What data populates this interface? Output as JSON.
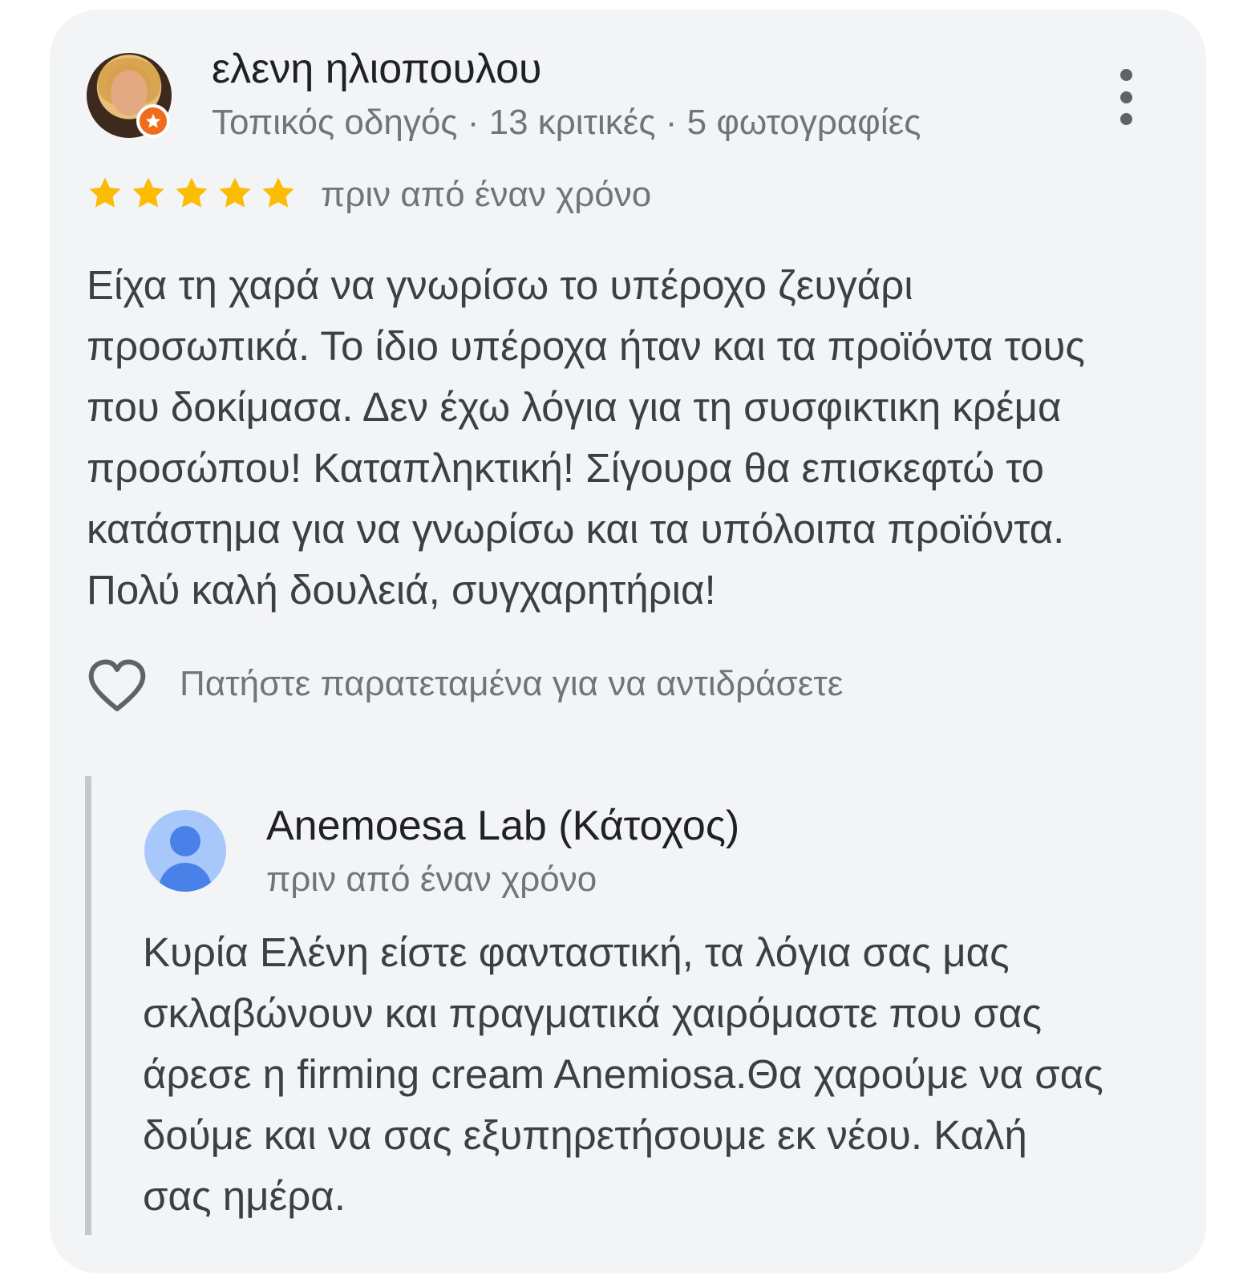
{
  "review": {
    "author_name": "ελενη ηλιοπουλου",
    "author_meta": "Τοπικός οδηγός · 13 κριτικές · 5 φωτογραφίες",
    "rating": 5,
    "rating_max": 5,
    "date": "πριν από έναν χρόνο",
    "text_lines": [
      "Είχα τη χαρά να γνωρίσω το υπέροχο ζευγάρι",
      "προσωπικά. Το ίδιο υπέροχα ήταν και τα προϊόντα τους",
      "που δοκίμασα. Δεν έχω λόγια για τη συσφικτικη κρέμα",
      "προσώπου! Καταπληκτική! Σίγουρα θα επισκεφτώ το",
      "κατάστημα για να γνωρίσω και τα υπόλοιπα προϊόντα.",
      "Πολύ καλή δουλειά, συγχαρητήρια!"
    ],
    "react_hint": "Πατήστε παρατεταμένα για να αντιδράσετε"
  },
  "reply": {
    "owner_name": "Anemoesa Lab (Κάτοχος)",
    "date": "πριν από έναν χρόνο",
    "text_lines": [
      "Κυρία Ελένη είστε φανταστική, τα λόγια σας μας",
      "σκλαβώνουν και πραγματικά χαιρόμαστε που σας",
      "άρεσε η firming cream Anemiosa.Θα χαρούμε να σας",
      "δούμε και να σας εξυπηρετήσουμε εκ νέου. Καλή",
      "σας ημέρα."
    ]
  },
  "icons": {
    "menu": "more-vert-icon",
    "star": "star-icon",
    "heart": "heart-outline-icon",
    "guide_badge": "local-guide-star-icon",
    "owner_avatar": "person-icon"
  },
  "colors": {
    "card_bg": "#f3f4f6",
    "star": "#fbbc04",
    "guide_badge": "#ef6c1a",
    "owner_avatar_bg": "#a8c7fa",
    "owner_avatar_fg": "#4a81e8"
  }
}
